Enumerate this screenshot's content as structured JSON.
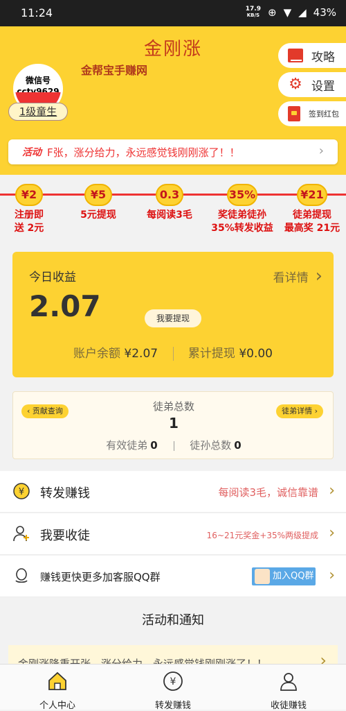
{
  "statusbar": {
    "time": "11:24",
    "speed": "17.9",
    "speed_unit": "KB/S",
    "battery": "43%"
  },
  "header": {
    "title": "金刚涨",
    "subtitle": "金帮宝手赚网",
    "avatar_text_1": "微信号",
    "avatar_text_2": "cctv9629",
    "level": "1级童生",
    "side_buttons": [
      {
        "label": "攻略",
        "icon": "book-icon"
      },
      {
        "label": "设置",
        "icon": "gear-icon"
      },
      {
        "label": "签到红包",
        "icon": "red-packet-icon"
      }
    ],
    "colors": {
      "brand": "#fdd232",
      "accent": "#e23a2a"
    }
  },
  "marquee": {
    "tag": "活动",
    "text": "F张，涨分给力，永远感觉钱刚刚涨了！！"
  },
  "features": [
    {
      "badge": "¥2",
      "label_1": "注册即",
      "label_2": "送 2元"
    },
    {
      "badge": "¥5",
      "label_1": "5元提现",
      "label_2": ""
    },
    {
      "badge": "0.3",
      "label_1": "每阅读3毛",
      "label_2": ""
    },
    {
      "badge": "35%",
      "label_1": "奖徒弟徒孙",
      "label_2": "35%转发收益"
    },
    {
      "badge": "¥21",
      "label_1": "徒弟提现",
      "label_2": "最高奖 21元"
    }
  ],
  "earnings": {
    "title": "今日收益",
    "detail": "看详情",
    "value": "2.07",
    "withdraw": "我要提现",
    "balance_label": "账户余额",
    "balance_value": "¥2.07",
    "withdrawn_label": "累计提现",
    "withdrawn_value": "¥0.00"
  },
  "disciples": {
    "left_pill": "贡献查询",
    "right_pill": "徒弟详情",
    "title": "徒弟总数",
    "total": "1",
    "valid_label": "有效徒弟",
    "valid_value": "0",
    "grand_label": "徒孙总数",
    "grand_value": "0"
  },
  "rows": [
    {
      "title": "转发赚钱",
      "note": "每阅读3毛，诚信靠谱"
    },
    {
      "title": "我要收徒",
      "note": "16~21元奖金+35%两级提成"
    },
    {
      "title": "赚钱更快更多加客服QQ群",
      "button": "加入QQ群"
    }
  ],
  "section": {
    "title": "活动和通知",
    "notice": "金刚涨隆重开张，涨分给力，永远感觉钱刚刚涨了！！"
  },
  "tabs": [
    {
      "label": "个人中心"
    },
    {
      "label": "转发赚钱"
    },
    {
      "label": "收徒赚钱"
    }
  ]
}
